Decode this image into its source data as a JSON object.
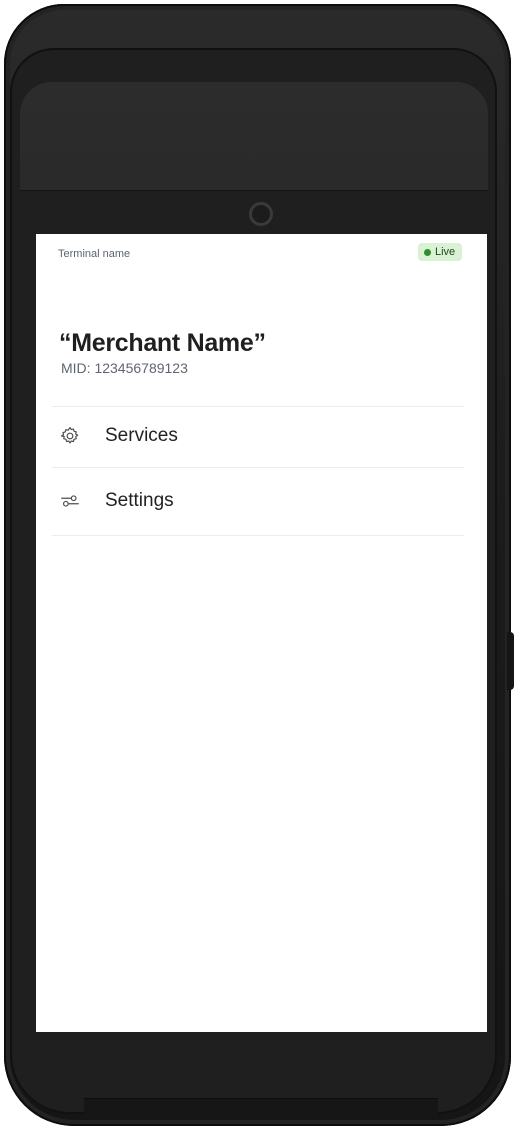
{
  "header": {
    "terminal_name": "Terminal name",
    "status": "Live",
    "status_color": "#2f8f2f",
    "status_background": "#d9f2d3"
  },
  "merchant": {
    "name": "“Merchant Name”",
    "mid": "MID: 123456789123"
  },
  "menu": {
    "items": [
      {
        "label": "Services",
        "icon": "gear-icon"
      },
      {
        "label": "Settings",
        "icon": "sliders-icon"
      }
    ]
  }
}
